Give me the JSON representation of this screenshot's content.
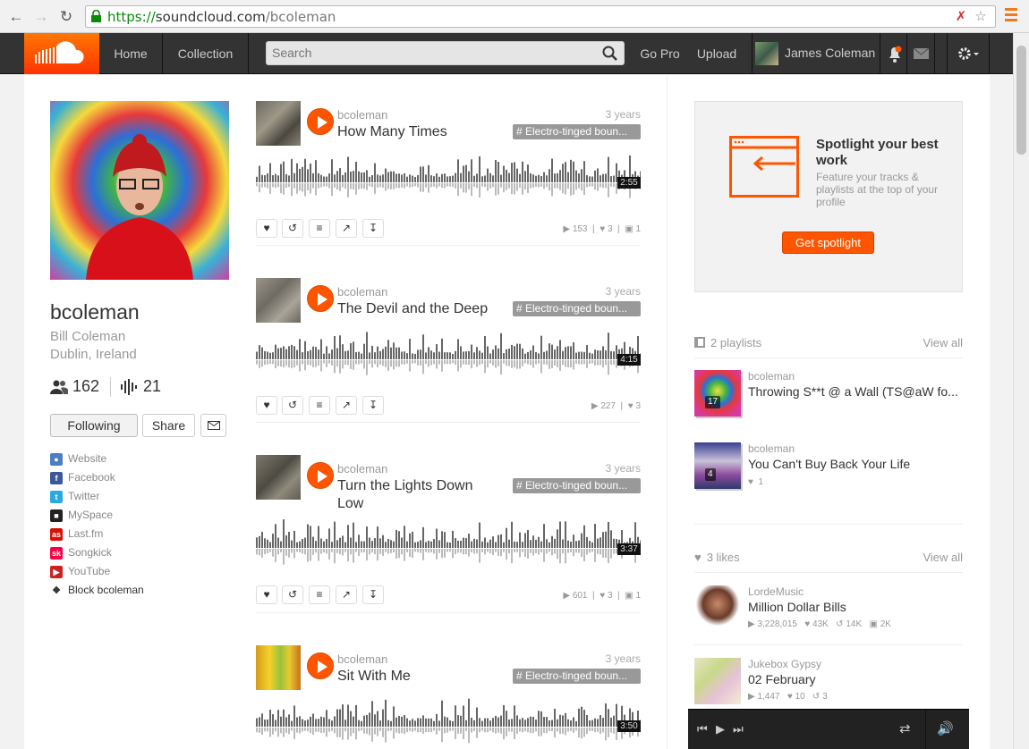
{
  "browser": {
    "url_scheme": "https://",
    "url_host": "soundcloud.com",
    "url_path": "/bcoleman"
  },
  "header": {
    "nav": [
      "Home",
      "Collection"
    ],
    "search_placeholder": "Search",
    "go_pro": "Go Pro",
    "upload": "Upload",
    "user_name": "James Coleman"
  },
  "profile": {
    "username": "bcoleman",
    "full_name": "Bill Coleman",
    "location": "Dublin, Ireland",
    "followers": "162",
    "tracks": "21",
    "following_label": "Following",
    "share_label": "Share",
    "links": [
      {
        "label": "Website",
        "icon": "globe-icon",
        "color": "#4a7fc1"
      },
      {
        "label": "Facebook",
        "icon": "facebook-icon",
        "color": "#3b5998"
      },
      {
        "label": "Twitter",
        "icon": "twitter-icon",
        "color": "#2aa9e0"
      },
      {
        "label": "MySpace",
        "icon": "myspace-icon",
        "color": "#222222"
      },
      {
        "label": "Last.fm",
        "icon": "lastfm-icon",
        "color": "#d51007"
      },
      {
        "label": "Songkick",
        "icon": "songkick-icon",
        "color": "#f80046"
      },
      {
        "label": "YouTube",
        "icon": "youtube-icon",
        "color": "#cd201f"
      }
    ],
    "block_label": "Block bcoleman"
  },
  "tracks": [
    {
      "user": "bcoleman",
      "title": "How Many Times",
      "time": "3 years",
      "tag": "# Electro-tinged boun...",
      "duration": "2:55",
      "plays": "153",
      "likes": "3",
      "comments": "1"
    },
    {
      "user": "bcoleman",
      "title": "The Devil and the Deep",
      "time": "3 years",
      "tag": "# Electro-tinged boun...",
      "duration": "4:15",
      "plays": "227",
      "likes": "3",
      "comments": ""
    },
    {
      "user": "bcoleman",
      "title": "Turn the Lights Down Low",
      "time": "3 years",
      "tag": "# Electro-tinged boun...",
      "duration": "3:37",
      "plays": "601",
      "likes": "3",
      "comments": "1"
    },
    {
      "user": "bcoleman",
      "title": "Sit With Me",
      "time": "3 years",
      "tag": "# Electro-tinged boun...",
      "duration": "3:50",
      "plays": "",
      "likes": "",
      "comments": ""
    }
  ],
  "spotlight": {
    "title": "Spotlight your best work",
    "text": "Feature your tracks & playlists at the top of your profile",
    "button": "Get spotlight"
  },
  "playlists": {
    "heading": "2 playlists",
    "view_all": "View all",
    "items": [
      {
        "user": "bcoleman",
        "title": "Throwing S**t @ a Wall (TS@aW fo...",
        "count": "17",
        "likes": ""
      },
      {
        "user": "bcoleman",
        "title": "You Can't Buy Back Your Life",
        "count": "4",
        "likes": "1"
      }
    ]
  },
  "likes": {
    "heading": "3 likes",
    "view_all": "View all",
    "items": [
      {
        "user": "LordeMusic",
        "title": "Million Dollar Bills",
        "plays": "3,228,015",
        "likes": "43K",
        "reposts": "14K",
        "comments": "2K"
      },
      {
        "user": "Jukebox Gypsy",
        "title": "02 February",
        "plays": "1,447",
        "likes": "10",
        "reposts": "3",
        "comments": ""
      }
    ]
  }
}
